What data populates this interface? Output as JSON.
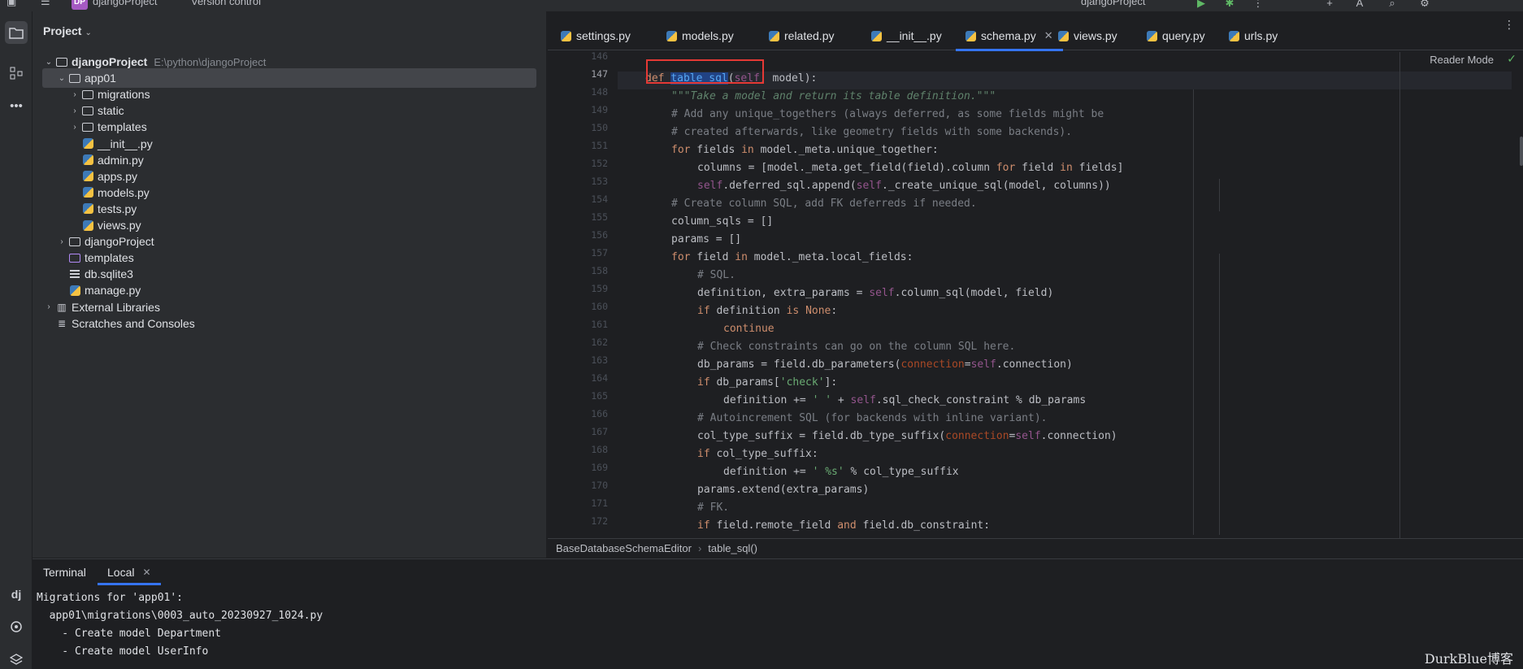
{
  "titlebar": {
    "project_badge": "DP",
    "project_name": "djangoProject",
    "vcs": "Version control",
    "right_project": "djangoProject"
  },
  "project_panel": {
    "title": "Project",
    "tree": [
      {
        "label": "djangoProject",
        "path": "E:\\python\\djangoProject",
        "type": "folder",
        "level": 0,
        "expanded": true
      },
      {
        "label": "app01",
        "type": "folder",
        "level": 1,
        "expanded": true,
        "selected": true
      },
      {
        "label": "migrations",
        "type": "folder",
        "level": 2
      },
      {
        "label": "static",
        "type": "folder",
        "level": 2
      },
      {
        "label": "templates",
        "type": "folder",
        "level": 2
      },
      {
        "label": "__init__.py",
        "type": "py",
        "level": 2
      },
      {
        "label": "admin.py",
        "type": "py",
        "level": 2
      },
      {
        "label": "apps.py",
        "type": "py",
        "level": 2
      },
      {
        "label": "models.py",
        "type": "py",
        "level": 2
      },
      {
        "label": "tests.py",
        "type": "py",
        "level": 2
      },
      {
        "label": "views.py",
        "type": "py",
        "level": 2
      },
      {
        "label": "djangoProject",
        "type": "folder",
        "level": 1
      },
      {
        "label": "templates",
        "type": "folder-purple",
        "level": 1
      },
      {
        "label": "db.sqlite3",
        "type": "db",
        "level": 1
      },
      {
        "label": "manage.py",
        "type": "py",
        "level": 1
      },
      {
        "label": "External Libraries",
        "type": "lib",
        "level": 0
      },
      {
        "label": "Scratches and Consoles",
        "type": "scratch",
        "level": 0
      }
    ]
  },
  "editor": {
    "tabs": [
      "settings.py",
      "models.py",
      "related.py",
      "__init__.py",
      "schema.py",
      "views.py",
      "query.py",
      "urls.py"
    ],
    "active_tab": "schema.py",
    "reader_mode": "Reader Mode",
    "line_numbers": [
      "146",
      "147",
      "148",
      "149",
      "150",
      "151",
      "152",
      "153",
      "154",
      "155",
      "156",
      "157",
      "158",
      "159",
      "160",
      "161",
      "162",
      "163",
      "164",
      "165",
      "166",
      "167",
      "168",
      "169",
      "170",
      "171",
      "172"
    ],
    "current_line": "147",
    "breadcrumbs": [
      "BaseDatabaseSchemaEditor",
      "table_sql()"
    ]
  },
  "terminal": {
    "title": "Terminal",
    "tab": "Local",
    "lines": [
      "Migrations for 'app01':",
      "  app01\\migrations\\0003_auto_20230927_1024.py",
      "    - Create model Department",
      "    - Create model UserInfo"
    ]
  },
  "watermark": "DurkBlue博客"
}
